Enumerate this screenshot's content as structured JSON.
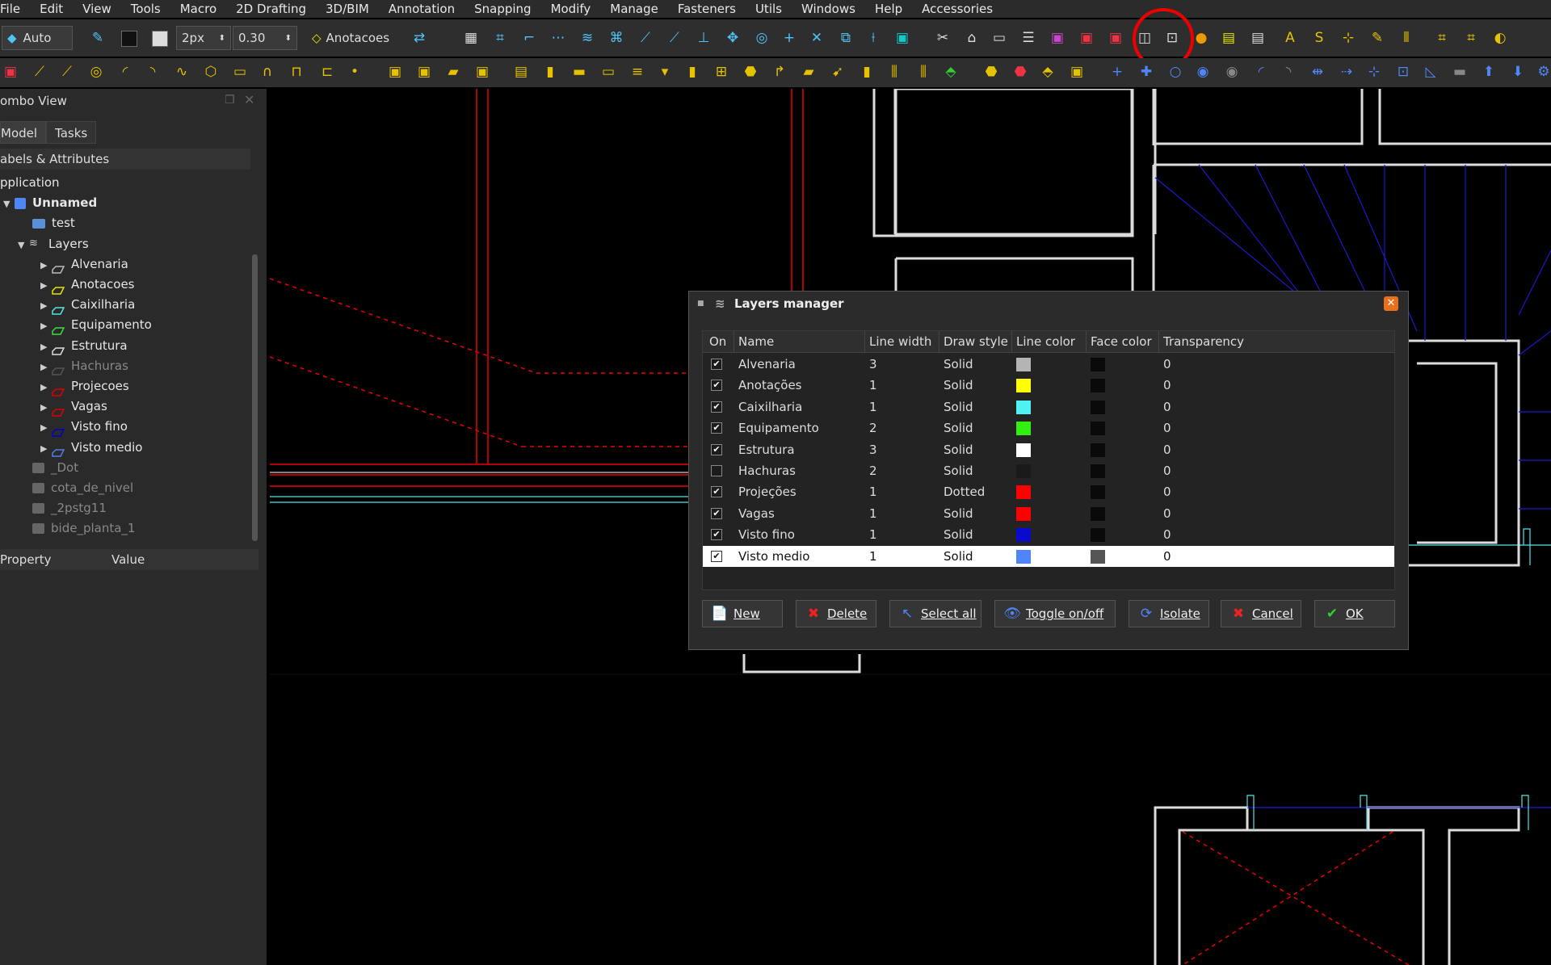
{
  "menu": [
    "File",
    "Edit",
    "View",
    "Tools",
    "Macro",
    "2D Drafting",
    "3D/BIM",
    "Annotation",
    "Snapping",
    "Modify",
    "Manage",
    "Fasteners",
    "Utils",
    "Windows",
    "Help",
    "Accessories"
  ],
  "toolbar": {
    "mode_label": "Auto",
    "line_width_value": "2px",
    "font_size_value": "0.30",
    "layer_label": "Anotacoes"
  },
  "sidebar": {
    "title": "ombo View",
    "tabs": [
      "Model",
      "Tasks"
    ],
    "labels_header": "abels & Attributes",
    "tree": [
      {
        "label": "pplication",
        "indent": 0,
        "arrow": "",
        "icon": "none",
        "dim": false
      },
      {
        "label": "Unnamed",
        "indent": 1,
        "arrow": "▼",
        "icon": "doc",
        "dim": false,
        "bold": true
      },
      {
        "label": "test",
        "indent": 2,
        "arrow": "",
        "icon": "folder",
        "dim": false
      },
      {
        "label": "Layers",
        "indent": 2,
        "arrow": "▼",
        "icon": "layers",
        "dim": false
      },
      {
        "label": "Alvenaria",
        "indent": 3,
        "arrow": "▶",
        "icon": "layer",
        "color": "#bbbbbb",
        "dim": false
      },
      {
        "label": "Anotacoes",
        "indent": 3,
        "arrow": "▶",
        "icon": "layer",
        "color": "#e6e600",
        "dim": false
      },
      {
        "label": "Caixilharia",
        "indent": 3,
        "arrow": "▶",
        "icon": "layer",
        "color": "#4fe6e6",
        "dim": false
      },
      {
        "label": "Equipamento",
        "indent": 3,
        "arrow": "▶",
        "icon": "layer",
        "color": "#3ddc3d",
        "dim": false
      },
      {
        "label": "Estrutura",
        "indent": 3,
        "arrow": "▶",
        "icon": "layer",
        "color": "#dddddd",
        "dim": false
      },
      {
        "label": "Hachuras",
        "indent": 3,
        "arrow": "▶",
        "icon": "layer",
        "color": "#555555",
        "dim": true
      },
      {
        "label": "Projecoes",
        "indent": 3,
        "arrow": "▶",
        "icon": "layer",
        "color": "#e00000",
        "dim": false
      },
      {
        "label": "Vagas",
        "indent": 3,
        "arrow": "▶",
        "icon": "layer",
        "color": "#e00000",
        "dim": false
      },
      {
        "label": "Visto fino",
        "indent": 3,
        "arrow": "▶",
        "icon": "layer",
        "color": "#0000c8",
        "dim": false
      },
      {
        "label": "Visto medio",
        "indent": 3,
        "arrow": "▶",
        "icon": "layer",
        "color": "#4f7fe6",
        "dim": false
      },
      {
        "label": "_Dot",
        "indent": 2,
        "arrow": "",
        "icon": "gray",
        "dim": true
      },
      {
        "label": "cota_de_nivel",
        "indent": 2,
        "arrow": "",
        "icon": "gray",
        "dim": true
      },
      {
        "label": "_2pstg11",
        "indent": 2,
        "arrow": "",
        "icon": "gray",
        "dim": true
      },
      {
        "label": "bide_planta_1",
        "indent": 2,
        "arrow": "",
        "icon": "gray",
        "dim": true
      }
    ],
    "property_header": "Property",
    "value_header": "Value"
  },
  "dialog": {
    "title": "Layers manager",
    "columns": [
      "On",
      "Name",
      "Line width",
      "Draw style",
      "Line color",
      "Face color",
      "Transparency"
    ],
    "rows": [
      {
        "on": true,
        "name": "Alvenaria",
        "line_width": "3",
        "draw_style": "Solid",
        "line_color": "#b4b4b4",
        "face_color": "#0a0a0a",
        "transparency": "0"
      },
      {
        "on": true,
        "name": "Anotações",
        "line_width": "1",
        "draw_style": "Solid",
        "line_color": "#ffff00",
        "face_color": "#0a0a0a",
        "transparency": "0"
      },
      {
        "on": true,
        "name": "Caixilharia",
        "line_width": "1",
        "draw_style": "Solid",
        "line_color": "#4ff2f2",
        "face_color": "#0a0a0a",
        "transparency": "0"
      },
      {
        "on": true,
        "name": "Equipamento",
        "line_width": "2",
        "draw_style": "Solid",
        "line_color": "#33ee11",
        "face_color": "#0a0a0a",
        "transparency": "0"
      },
      {
        "on": true,
        "name": "Estrutura",
        "line_width": "3",
        "draw_style": "Solid",
        "line_color": "#ffffff",
        "face_color": "#0a0a0a",
        "transparency": "0"
      },
      {
        "on": false,
        "name": "Hachuras",
        "line_width": "2",
        "draw_style": "Solid",
        "line_color": "#1a1a1a",
        "face_color": "#0a0a0a",
        "transparency": "0"
      },
      {
        "on": true,
        "name": "Projeções",
        "line_width": "1",
        "draw_style": "Dotted",
        "line_color": "#ff0000",
        "face_color": "#0a0a0a",
        "transparency": "0"
      },
      {
        "on": true,
        "name": "Vagas",
        "line_width": "1",
        "draw_style": "Solid",
        "line_color": "#ff0000",
        "face_color": "#0a0a0a",
        "transparency": "0"
      },
      {
        "on": true,
        "name": "Visto fino",
        "line_width": "1",
        "draw_style": "Solid",
        "line_color": "#0a0acc",
        "face_color": "#0a0a0a",
        "transparency": "0"
      },
      {
        "on": true,
        "name": "Visto medio",
        "line_width": "1",
        "draw_style": "Solid",
        "line_color": "#4f86f7",
        "face_color": "#555555",
        "transparency": "0",
        "selected": true
      }
    ],
    "buttons": [
      {
        "label": "New",
        "icon": "📄"
      },
      {
        "label": "Delete",
        "icon": "✖"
      },
      {
        "label": "Select all",
        "icon": "↖"
      },
      {
        "label": "Toggle on/off",
        "icon": "👁"
      },
      {
        "label": "Isolate",
        "icon": "⟳"
      },
      {
        "label": "Cancel",
        "icon": "✖"
      },
      {
        "label": "OK",
        "icon": "✔"
      }
    ]
  }
}
